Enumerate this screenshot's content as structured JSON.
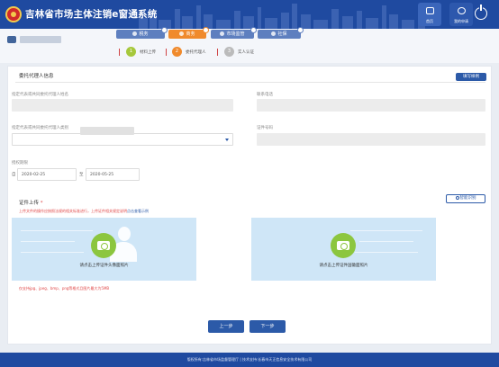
{
  "header": {
    "title": "吉林省市场主体注销e窗通系统",
    "home_label": "首页",
    "mine_label": "我的申请",
    "brand_color": "#1f4aa0"
  },
  "user": {
    "name": ""
  },
  "chips": [
    {
      "label": "税务",
      "count": "",
      "active": false
    },
    {
      "label": "商务",
      "count": "",
      "active": true
    },
    {
      "label": "市场监管",
      "count": "",
      "active": false
    },
    {
      "label": "社保",
      "count": "",
      "active": false
    }
  ],
  "steps": [
    {
      "num": "1",
      "label": "材料上传",
      "status": "done"
    },
    {
      "num": "2",
      "label": "委托代理人",
      "status": "current"
    },
    {
      "num": "3",
      "label": "实人认证",
      "status": "todo"
    }
  ],
  "section": {
    "title": "委托代理人信息",
    "template_button": "填写样例"
  },
  "form": {
    "agent_name_label": "指定代表或共同委托代理人姓名",
    "agent_name_value": "",
    "phone_label": "联系电话",
    "phone_value": "",
    "id_type_label": "指定代表或共同委托代理人类别",
    "id_type_value": "",
    "id_number_label": "证件号码",
    "id_number_value": "",
    "period_label": "授权期限",
    "from_label": "自",
    "from_date": "2020-02-25",
    "to_label": "至",
    "to_date": "2020-05-25"
  },
  "upload": {
    "title": "证件上传",
    "required_mark": "*",
    "warning": "上传文件的操作应按照法规的相关标准进行，上传证件相关规定说明",
    "warning_link": "点击查看示例",
    "ocr_button": "智能识别",
    "front_text": "请点击上传证件头像面照片",
    "back_text": "请点击上传证件国徽面照片",
    "format_hint": "仅支持jpg、jpeg、bmp、png等格式且图片最大为5MB"
  },
  "actions": {
    "prev_label": "上一步",
    "next_label": "下一步"
  },
  "footer": {
    "text": "版权所有:吉林省市场监督管理厅 | 技术支持:长春市天正信息安全技术有限公司"
  }
}
